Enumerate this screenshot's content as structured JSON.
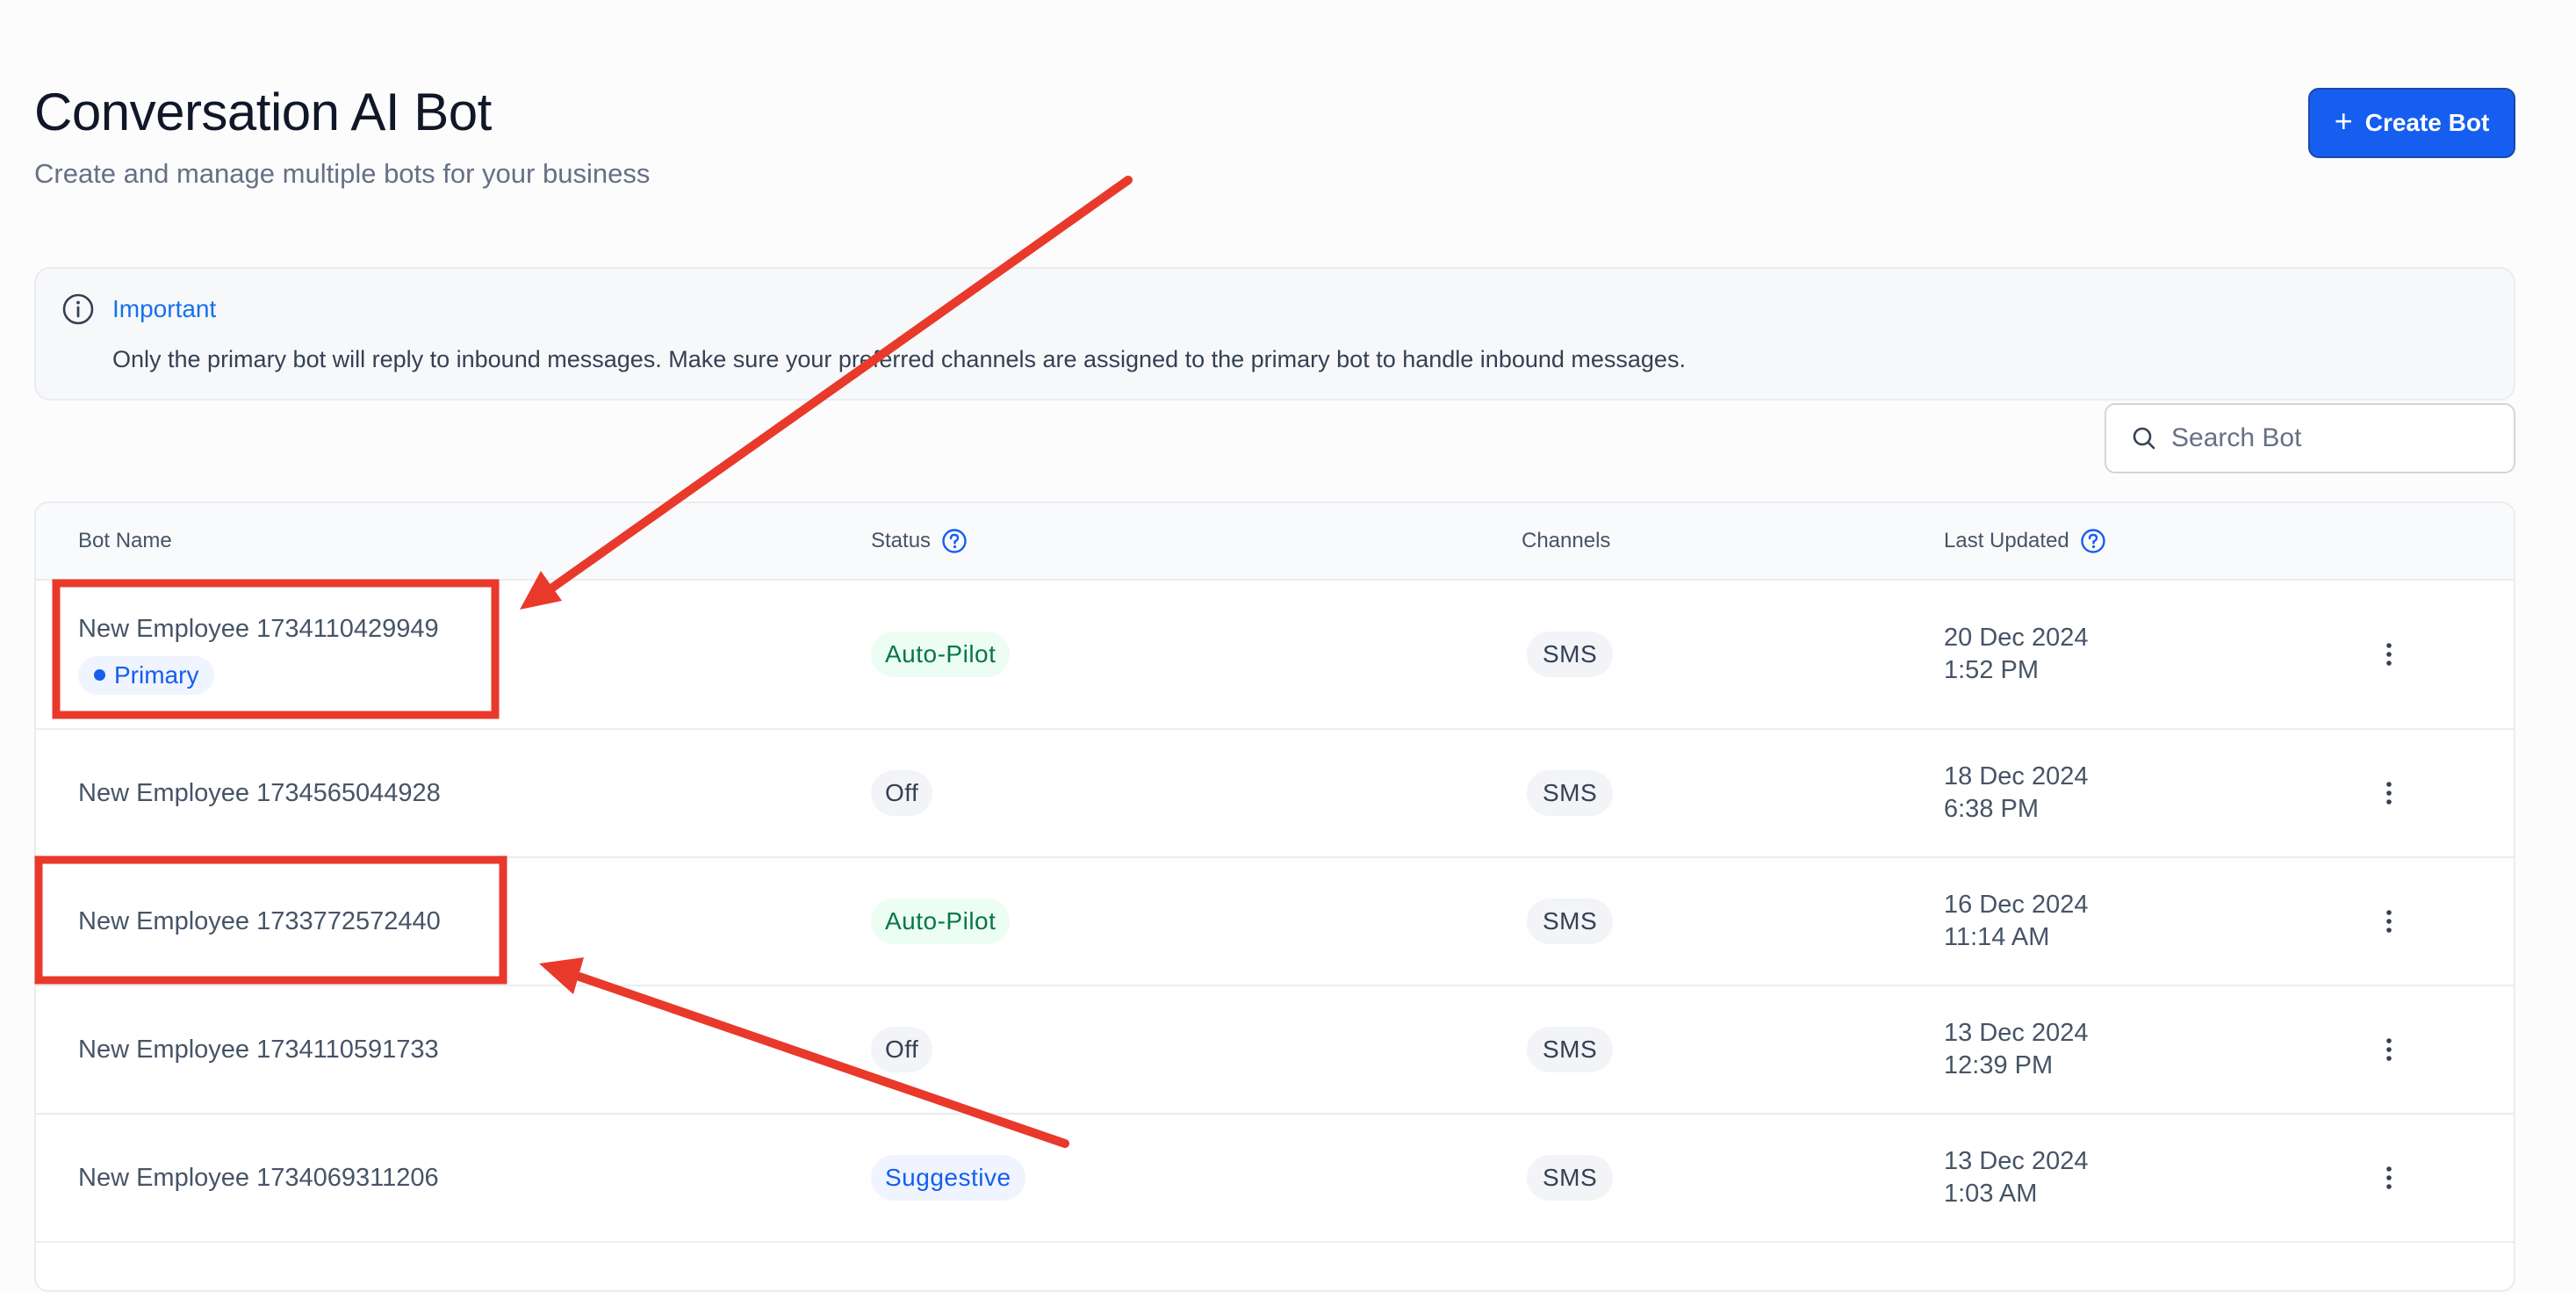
{
  "page": {
    "title": "Conversation AI Bot",
    "subtitle": "Create and manage multiple bots for your business",
    "create_button_label": "Create Bot"
  },
  "alert": {
    "title": "Important",
    "message": "Only the primary bot will reply to inbound messages. Make sure your preferred channels are assigned to the primary bot to handle inbound messages."
  },
  "search": {
    "placeholder": "Search Bot",
    "value": ""
  },
  "table": {
    "headers": {
      "name": "Bot Name",
      "status": "Status",
      "channels": "Channels",
      "updated": "Last Updated"
    },
    "rows": [
      {
        "name": "New Employee 1734110429949",
        "badge": "Primary",
        "status": "Auto-Pilot",
        "channel": "SMS",
        "date": "20 Dec 2024",
        "time": "1:52 PM"
      },
      {
        "name": "New Employee 1734565044928",
        "status": "Off",
        "channel": "SMS",
        "date": "18 Dec 2024",
        "time": "6:38 PM"
      },
      {
        "name": "New Employee 1733772572440",
        "status": "Auto-Pilot",
        "channel": "SMS",
        "date": "16 Dec 2024",
        "time": "11:14 AM"
      },
      {
        "name": "New Employee 1734110591733",
        "status": "Off",
        "channel": "SMS",
        "date": "13 Dec 2024",
        "time": "12:39 PM"
      },
      {
        "name": "New Employee 1734069311206",
        "status": "Suggestive",
        "channel": "SMS",
        "date": "13 Dec 2024",
        "time": "1:03 AM"
      }
    ]
  },
  "colors": {
    "accent": "#155eef",
    "annotation": "#e8392b"
  }
}
